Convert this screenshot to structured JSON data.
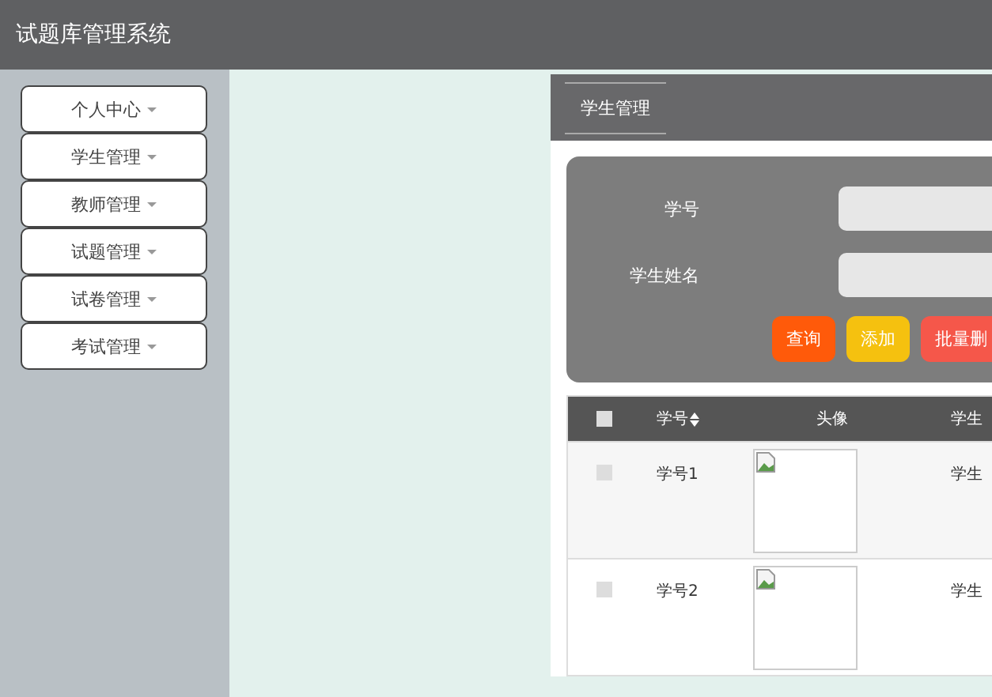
{
  "header": {
    "title": "试题库管理系统"
  },
  "sidebar": {
    "items": [
      {
        "label": "个人中心"
      },
      {
        "label": "学生管理"
      },
      {
        "label": "教师管理"
      },
      {
        "label": "试题管理"
      },
      {
        "label": "试卷管理"
      },
      {
        "label": "考试管理"
      }
    ]
  },
  "panel": {
    "tab": "学生管理",
    "search": {
      "fields": [
        {
          "label": "学号"
        },
        {
          "label": "学生姓名"
        }
      ],
      "buttons": [
        {
          "label": "查询",
          "kind": "query"
        },
        {
          "label": "添加",
          "kind": "add"
        },
        {
          "label": "批量删",
          "kind": "delete"
        }
      ]
    },
    "table": {
      "all_checked": false,
      "columns": [
        {
          "label": "学号",
          "sortable": true
        },
        {
          "label": "头像",
          "sortable": false
        },
        {
          "label": "学生",
          "sortable": false
        }
      ],
      "rows": [
        {
          "checked": false,
          "cells": [
            "学号1",
            "学生"
          ]
        },
        {
          "checked": false,
          "cells": [
            "学号2",
            "学生"
          ]
        }
      ]
    }
  }
}
